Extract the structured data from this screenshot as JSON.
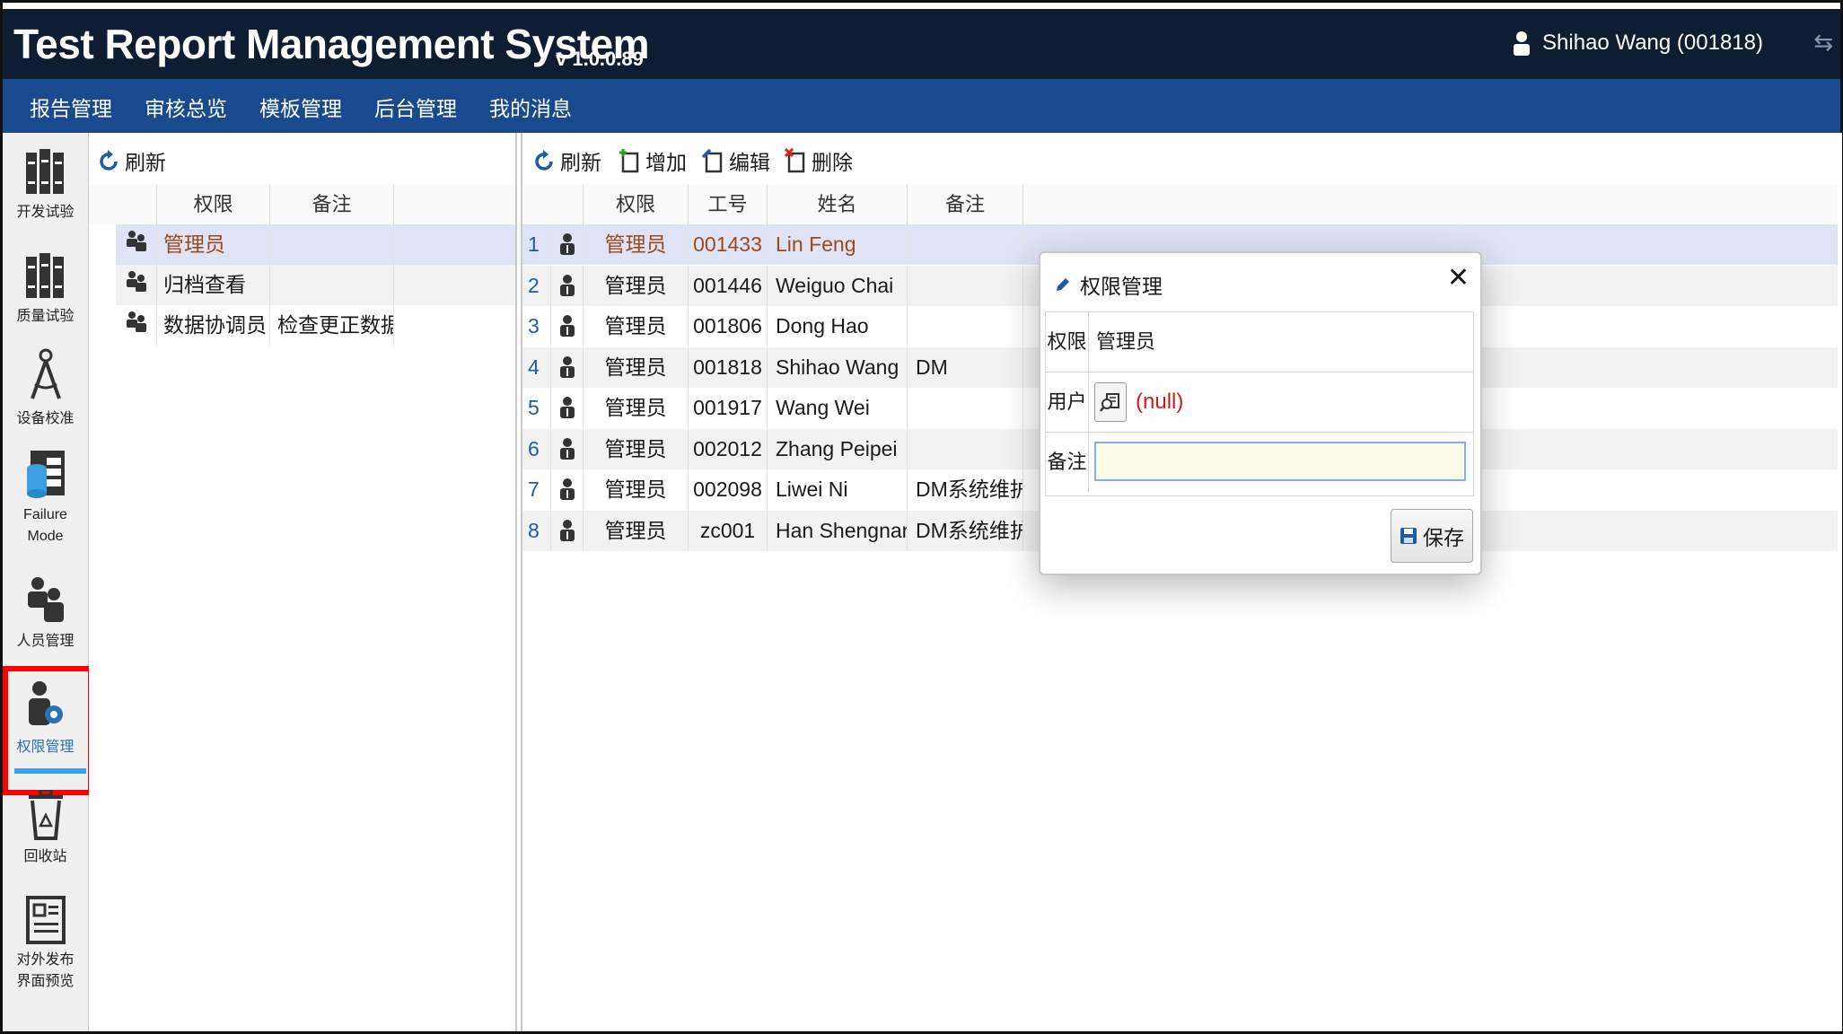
{
  "header": {
    "title": "Test Report Management System",
    "version": "v 1.0.0.89",
    "user": "Shihao Wang (001818)"
  },
  "menu": [
    "报告管理",
    "审核总览",
    "模板管理",
    "后台管理",
    "我的消息"
  ],
  "nav": [
    {
      "label": "开发试验",
      "icon": "books-icon"
    },
    {
      "label": "质量试验",
      "icon": "books-icon"
    },
    {
      "label": "设备校准",
      "icon": "compass-icon"
    },
    {
      "label": "Failure Mode",
      "icon": "database-table-icon"
    },
    {
      "label": "人员管理",
      "icon": "people-icon"
    },
    {
      "label": "权限管理",
      "icon": "user-gear-icon",
      "active": true
    },
    {
      "label": "回收站",
      "icon": "recycle-bin-icon"
    },
    {
      "label": "对外发布界面预览",
      "icon": "preview-page-icon"
    }
  ],
  "roles": {
    "toolbar": {
      "refresh": "刷新"
    },
    "columns": [
      "权限",
      "备注"
    ],
    "rows": [
      {
        "role": "管理员",
        "remark": "",
        "selected": true
      },
      {
        "role": "归档查看",
        "remark": ""
      },
      {
        "role": "数据协调员",
        "remark": "检查更正数据"
      }
    ]
  },
  "users": {
    "toolbar": {
      "refresh": "刷新",
      "add": "增加",
      "edit": "编辑",
      "delete": "删除"
    },
    "columns": [
      "权限",
      "工号",
      "姓名",
      "备注"
    ],
    "rows": [
      {
        "n": "1",
        "role": "管理员",
        "id": "001433",
        "name": "Lin Feng",
        "remark": "",
        "selected": true
      },
      {
        "n": "2",
        "role": "管理员",
        "id": "001446",
        "name": "Weiguo Chai",
        "remark": ""
      },
      {
        "n": "3",
        "role": "管理员",
        "id": "001806",
        "name": "Dong Hao",
        "remark": ""
      },
      {
        "n": "4",
        "role": "管理员",
        "id": "001818",
        "name": "Shihao Wang",
        "remark": "DM"
      },
      {
        "n": "5",
        "role": "管理员",
        "id": "001917",
        "name": "Wang Wei",
        "remark": ""
      },
      {
        "n": "6",
        "role": "管理员",
        "id": "002012",
        "name": "Zhang Peipei",
        "remark": ""
      },
      {
        "n": "7",
        "role": "管理员",
        "id": "002098",
        "name": "Liwei Ni",
        "remark": "DM系统维护"
      },
      {
        "n": "8",
        "role": "管理员",
        "id": "zc001",
        "name": "Han Shengnan",
        "remark": "DM系统维护"
      }
    ]
  },
  "dialog": {
    "title": "权限管理",
    "role_label": "权限",
    "role_value": "管理员",
    "user_label": "用户",
    "user_value": "(null)",
    "remark_label": "备注",
    "remark_value": "",
    "save": "保存"
  },
  "colors": {
    "titlebar": "#0f1d33",
    "menubar": "#1a4a8e",
    "selected_row": "#dfe3f5",
    "alt_row": "#f2f2f2",
    "selected_text": "#9a4a1e",
    "null_text": "#d21a1a",
    "highlight": "#ff0000"
  }
}
